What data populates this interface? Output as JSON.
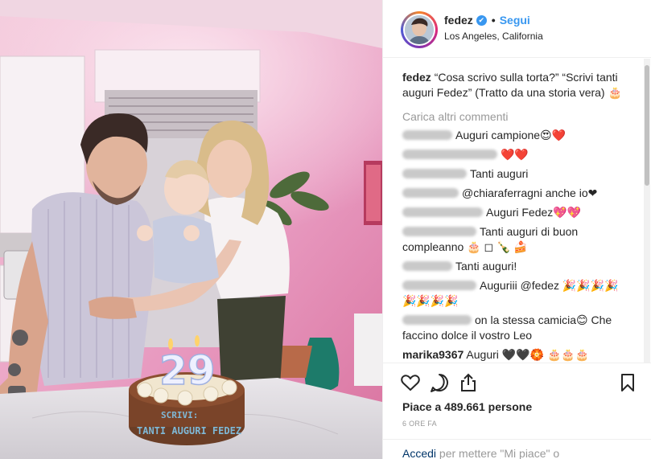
{
  "photo": {
    "cake_number": "29",
    "cake_text_line1": "SCRIVI:",
    "cake_text_line2": "TANTI AUGURI FEDEZ"
  },
  "header": {
    "username": "fedez",
    "verified_mark": "✔",
    "follow_label": "Segui",
    "location": "Los Angeles, California"
  },
  "caption": {
    "username": "fedez",
    "text": "“Cosa scrivo sulla torta?” “Scrivi tanti auguri Fedez” (Tratto da una storia vera) 🎂"
  },
  "load_more_label": "Carica altri commenti",
  "comments": [
    {
      "text": "Auguri campione😍❤️"
    },
    {
      "text": "❤️❤️"
    },
    {
      "text": "Tanti auguri"
    },
    {
      "text": "@chiaraferragni anche io❤"
    },
    {
      "text": "Auguri Fedez💖💖"
    },
    {
      "text": "Tanti auguri di buon compleanno 🎂 ◻ 🍾 🍰"
    },
    {
      "text": "Tanti auguri!"
    },
    {
      "text": "Auguriii @fedez 🎉🎉🎉🎉 🎉🎉🎉🎉"
    },
    {
      "text": "on la stessa camicia😊 Che faccino dolce il vostro Leo"
    },
    {
      "user": "marika9367",
      "text": "Auguri 🖤🖤🏵️ 🎂🎂🎂"
    }
  ],
  "likes_text": "Piace a 489.661 persone",
  "time_text": "6 ORE FA",
  "login": {
    "link_label": "Accedi",
    "rest_text": "per mettere \"Mi piace\" o"
  },
  "icons": [
    "heart-icon",
    "comment-icon",
    "share-icon",
    "bookmark-icon"
  ],
  "colors": {
    "accent": "#3897f0",
    "muted": "#999999",
    "wall_pink": "#e9a9c6"
  }
}
